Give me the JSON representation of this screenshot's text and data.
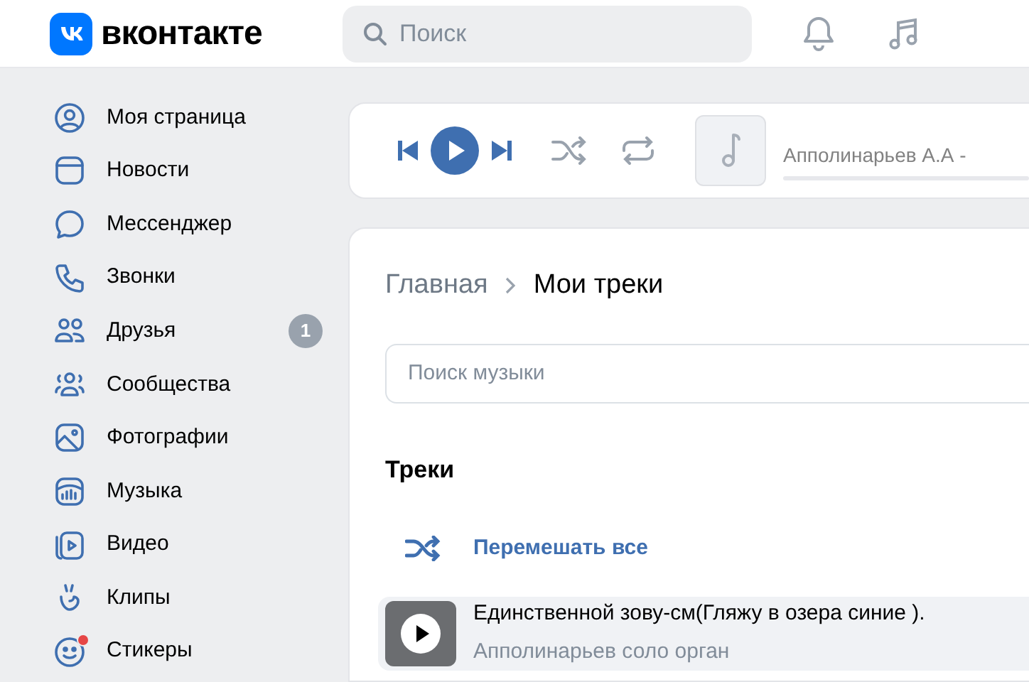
{
  "header": {
    "logo_text": "вконтакте",
    "search": {
      "placeholder": "Поиск"
    }
  },
  "sidebar": {
    "items": [
      {
        "label": "Моя страница",
        "dot": false
      },
      {
        "label": "Новости",
        "dot": false
      },
      {
        "label": "Мессенджер",
        "dot": false
      },
      {
        "label": "Звонки",
        "dot": false
      },
      {
        "label": "Друзья",
        "badge": "1",
        "dot": false
      },
      {
        "label": "Сообщества",
        "dot": false
      },
      {
        "label": "Фотографии",
        "dot": false
      },
      {
        "label": "Музыка",
        "dot": false
      },
      {
        "label": "Видео",
        "dot": false
      },
      {
        "label": "Клипы",
        "dot": false
      },
      {
        "label": "Стикеры",
        "dot": true
      }
    ]
  },
  "player": {
    "playing": false,
    "track_text": "Апполинарьев А.А -"
  },
  "content": {
    "breadcrumbs": [
      "Главная",
      "Мои треки"
    ],
    "search": {
      "placeholder": "Поиск музыки"
    },
    "section_title": "Треки",
    "shuffle_label": "Перемешать все",
    "tracks": [
      {
        "title": "Единственной зову-см(Гляжу в озера синие ).",
        "artist": "Апполинарьев соло орган",
        "hovered": true
      }
    ]
  }
}
